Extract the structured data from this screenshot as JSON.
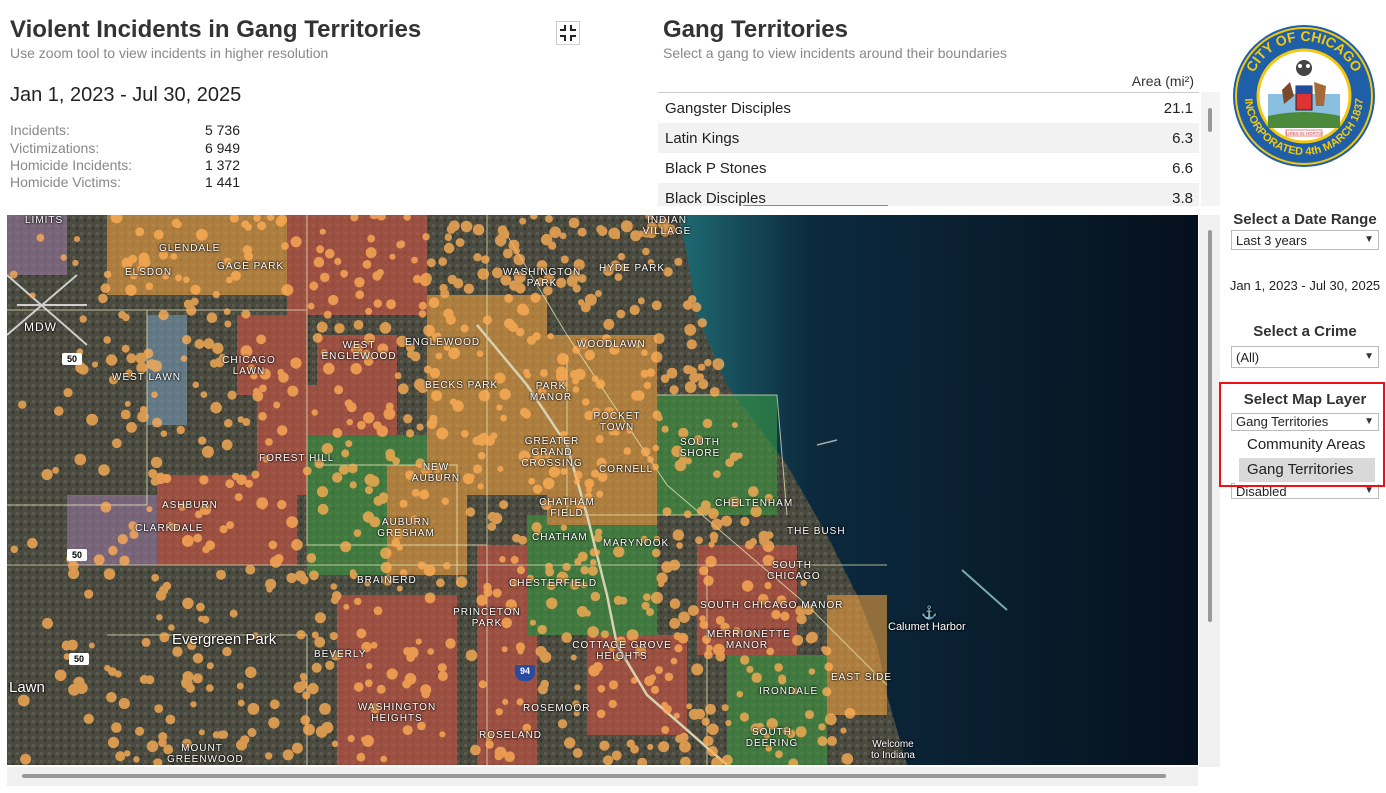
{
  "header": {
    "title": "Violent Incidents in Gang Territories",
    "subtitle": "Use zoom tool to view incidents in higher resolution",
    "date_range": "Jan 1, 2023 - Jul 30, 2025"
  },
  "stats": [
    {
      "label": "Incidents:",
      "value": "5 736"
    },
    {
      "label": "Victimizations:",
      "value": "6 949"
    },
    {
      "label": "Homicide Incidents:",
      "value": "1 372"
    },
    {
      "label": "Homicide Victims:",
      "value": "1 441"
    }
  ],
  "gang_panel": {
    "title": "Gang Territories",
    "subtitle": "Select a gang to view incidents around their boundaries",
    "area_header": "Area (mi²)",
    "rows": [
      {
        "name": "Gangster Disciples",
        "area": "21.1"
      },
      {
        "name": "Latin Kings",
        "area": "6.3"
      },
      {
        "name": "Black P Stones",
        "area": "6.6"
      },
      {
        "name": "Black Disciples",
        "area": "3.8"
      }
    ]
  },
  "seal": {
    "text_top": "CITY OF CHICAGO",
    "text_bottom": "INCORPORATED 4th MARCH 1837",
    "motto": "URBS IN HORTO"
  },
  "map": {
    "labels": [
      {
        "text": "LIMITS"
      },
      {
        "text": "GLENDALE"
      },
      {
        "text": "ELSDON"
      },
      {
        "text": "GAGE PARK"
      },
      {
        "text": "WASHINGTON PARK"
      },
      {
        "text": "HYDE PARK"
      },
      {
        "text": "INDIAN VILLAGE"
      },
      {
        "text": "MDW"
      },
      {
        "text": "CHICAGO LAWN"
      },
      {
        "text": "WEST ENGLEWOOD"
      },
      {
        "text": "ENGLEWOOD"
      },
      {
        "text": "WOODLAWN"
      },
      {
        "text": "WEST LAWN"
      },
      {
        "text": "BECKS PARK"
      },
      {
        "text": "PARK MANOR"
      },
      {
        "text": "POCKET TOWN"
      },
      {
        "text": "GREATER GRAND CROSSING"
      },
      {
        "text": "SOUTH SHORE"
      },
      {
        "text": "FOREST HILL"
      },
      {
        "text": "NEW AUBURN"
      },
      {
        "text": "CORNELL"
      },
      {
        "text": "CHATHAM FIELD"
      },
      {
        "text": "CHELTENHAM"
      },
      {
        "text": "ASHBURN"
      },
      {
        "text": "CLARKDALE"
      },
      {
        "text": "AUBURN GRESHAM"
      },
      {
        "text": "CHATHAM"
      },
      {
        "text": "MARYNOOK"
      },
      {
        "text": "THE BUSH"
      },
      {
        "text": "BRAINERD"
      },
      {
        "text": "CHESTERFIELD"
      },
      {
        "text": "SOUTH CHICAGO"
      },
      {
        "text": "PRINCETON PARK"
      },
      {
        "text": "SOUTH CHICAGO MANOR"
      },
      {
        "text": "Evergreen Park"
      },
      {
        "text": "BEVERLY"
      },
      {
        "text": "COTTAGE GROVE HEIGHTS"
      },
      {
        "text": "MERRIONETTE MANOR"
      },
      {
        "text": "Calumet Harbor"
      },
      {
        "text": "Lawn"
      },
      {
        "text": "IRONDALE"
      },
      {
        "text": "EAST SIDE"
      },
      {
        "text": "WASHINGTON HEIGHTS"
      },
      {
        "text": "ROSEMOOR"
      },
      {
        "text": "ROSELAND"
      },
      {
        "text": "SOUTH DEERING"
      },
      {
        "text": "Welcome to Indiana"
      },
      {
        "text": "MOUNT GREENWOOD"
      }
    ],
    "shields": [
      "50",
      "50",
      "50",
      "50",
      "94"
    ]
  },
  "controls": {
    "date_heading": "Select a Date Range",
    "date_value": "Last 3 years",
    "date_display": "Jan 1, 2023 - Jul 30, 2025",
    "crime_heading": "Select a Crime",
    "crime_value": "(All)",
    "layer_heading": "Select Map Layer",
    "layer_value": "Gang Territories",
    "layer_options": [
      "Community Areas",
      "Gang Territories"
    ],
    "disabled_value": "Disabled"
  },
  "colors": {
    "highlight": "#e11111",
    "incident_dot": "#ffae55",
    "water": "#0a1a2c"
  }
}
